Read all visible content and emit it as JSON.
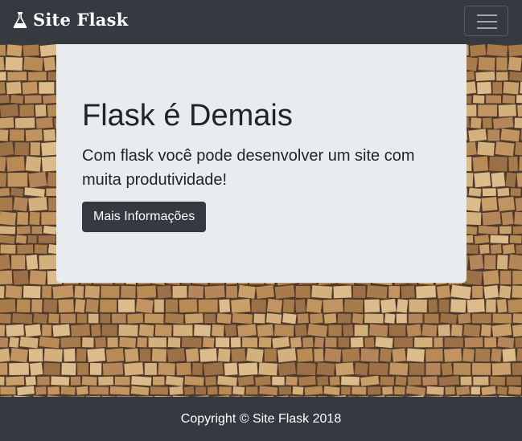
{
  "navbar": {
    "brand_icon": "flask-icon",
    "brand_text": "Site Flask",
    "toggler_icon": "hamburger-icon"
  },
  "hero": {
    "background": "wood-blocks-texture"
  },
  "jumbotron": {
    "title": "Flask é Demais",
    "lead": "Com flask você pode desenvolver um site com muita produtividade!",
    "button_label": "Mais Informações"
  },
  "footer": {
    "text": "Copyright © Site Flask 2018"
  },
  "colors": {
    "dark": "#343a40",
    "jumbotron_bg": "#e9ecef",
    "text": "#212529",
    "wood_light": "#c49a62",
    "wood_dark": "#5a4030"
  }
}
